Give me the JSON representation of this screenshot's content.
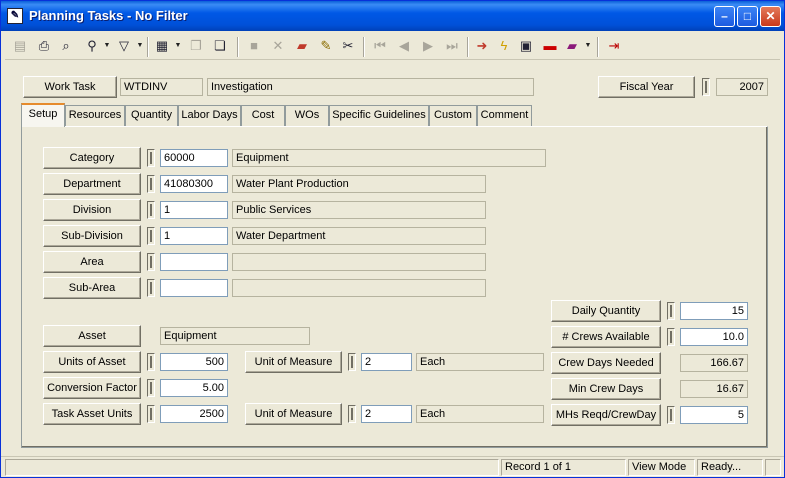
{
  "window": {
    "title": "Planning Tasks - No Filter",
    "app_icon": "edit-form-icon"
  },
  "toolbar": {
    "icons": [
      "view-icon",
      "print-icon",
      "preview-icon",
      "find-icon",
      "filter-icon",
      "report-icon",
      "copy-icon",
      "paste-icon",
      "disabled-new-icon",
      "disabled-delete-icon",
      "book-icon",
      "pencil-icon",
      "scissors-icon",
      "first-icon",
      "prev-icon",
      "next-icon",
      "last-icon",
      "arrow-right-icon",
      "lightning-icon",
      "window-icon",
      "clip-icon",
      "books-icon",
      "exit-icon"
    ]
  },
  "header": {
    "work_task_label": "Work Task",
    "work_task_code": "WTDINV",
    "work_task_desc": "Investigation",
    "fiscal_year_label": "Fiscal Year",
    "fiscal_year_value": "2007"
  },
  "tabs": [
    "Setup",
    "Resources",
    "Quantity",
    "Labor Days",
    "Cost",
    "WOs",
    "Specific Guidelines",
    "Custom",
    "Comment"
  ],
  "active_tab": "Setup",
  "setup": {
    "category": {
      "label": "Category",
      "code": "60000",
      "desc": "Equipment"
    },
    "department": {
      "label": "Department",
      "code": "41080300",
      "desc": "Water Plant Production"
    },
    "division": {
      "label": "Division",
      "code": "1",
      "desc": "Public Services"
    },
    "subdivision": {
      "label": "Sub-Division",
      "code": "1",
      "desc": "Water Department"
    },
    "area": {
      "label": "Area",
      "code": "",
      "desc": ""
    },
    "subarea": {
      "label": "Sub-Area",
      "code": "",
      "desc": ""
    },
    "asset": {
      "label": "Asset",
      "value": "Equipment"
    },
    "units_of_asset": {
      "label": "Units of Asset",
      "value": "500"
    },
    "uom1": {
      "label": "Unit of Measure",
      "code": "2",
      "desc": "Each"
    },
    "conversion_factor": {
      "label": "Conversion Factor",
      "value": "5.00"
    },
    "task_asset_units": {
      "label": "Task Asset Units",
      "value": "2500"
    },
    "uom2": {
      "label": "Unit of Measure",
      "code": "2",
      "desc": "Each"
    },
    "daily_quantity": {
      "label": "Daily Quantity",
      "value": "15"
    },
    "crews_available": {
      "label": "# Crews Available",
      "value": "10.0"
    },
    "crew_days_needed": {
      "label": "Crew Days Needed",
      "value": "166.67"
    },
    "min_crew_days": {
      "label": "Min Crew Days",
      "value": "16.67"
    },
    "mhs_reqd": {
      "label": "MHs Reqd/CrewDay",
      "value": "5"
    }
  },
  "status": {
    "record": "Record 1 of 1",
    "mode": "View Mode",
    "state": "Ready..."
  }
}
